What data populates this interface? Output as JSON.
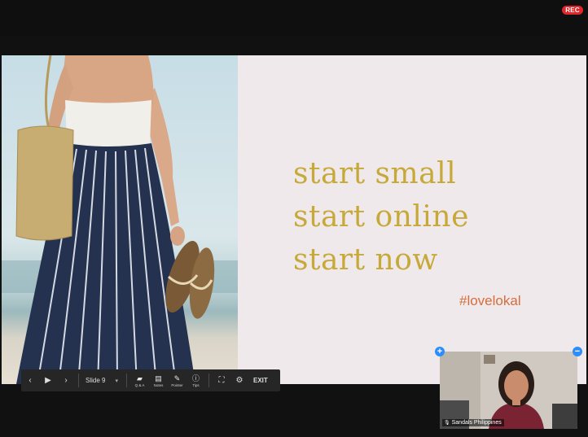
{
  "recording_badge": "REC",
  "slide": {
    "lines": [
      "start small",
      "start online",
      "start now"
    ],
    "hashtag": "#lovelokal",
    "text_color": "#c7a93a",
    "hashtag_color": "#d66d3b"
  },
  "controls": {
    "prev_icon": "chevron-left-icon",
    "play_icon": "play-icon",
    "next_icon": "chevron-right-icon",
    "slide_selector": "Slide 9",
    "tools": [
      {
        "label": "Q & A",
        "icon": "qa-icon"
      },
      {
        "label": "Notes",
        "icon": "notes-icon"
      },
      {
        "label": "Pointer",
        "icon": "pointer-icon"
      },
      {
        "label": "Tips",
        "icon": "info-icon"
      }
    ],
    "exit_label": "EXIT"
  },
  "participant": {
    "name": "Sandals Philippines",
    "accent": "#2d8cff"
  }
}
